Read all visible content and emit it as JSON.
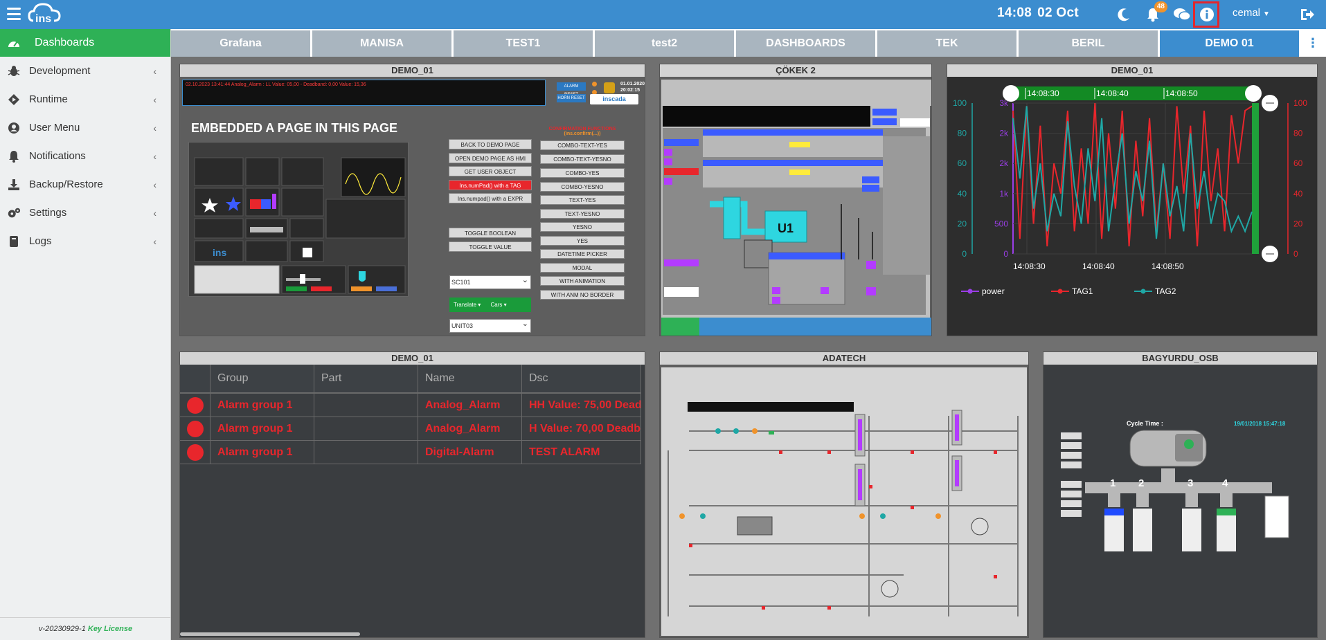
{
  "topbar": {
    "clock_time": "14:08",
    "clock_date": "02 Oct",
    "notifications_count": "48",
    "username": "cemal"
  },
  "sidebar": {
    "active": "Dashboards",
    "items": [
      {
        "label": "Development",
        "icon": "bug-icon"
      },
      {
        "label": "Runtime",
        "icon": "runtime-icon"
      },
      {
        "label": "User Menu",
        "icon": "user-circle-icon"
      },
      {
        "label": "Notifications",
        "icon": "bell-icon"
      },
      {
        "label": "Backup/Restore",
        "icon": "download-icon"
      },
      {
        "label": "Settings",
        "icon": "gears-icon"
      },
      {
        "label": "Logs",
        "icon": "book-icon"
      }
    ],
    "version": "v-20230929-1",
    "license": "Key License"
  },
  "tabs": [
    "Grafana",
    "MANISA",
    "TEST1",
    "test2",
    "DASHBOARDS",
    "TEK",
    "BERIL",
    "DEMO 01"
  ],
  "panels": {
    "p1": {
      "title": "DEMO_01",
      "alarm_msg": "02.10.2023 13:41:44 Analog_Alarm : LL Value: 05,00 - Deadband: 0,00 Value: 15,36",
      "alarm_reset": "ALARM RESET",
      "horn_reset": "HORN RESET",
      "datetime": "01.01.2020 20:02:15",
      "brand": "inscada",
      "heading": "EMBEDDED A PAGE IN THIS PAGE",
      "buttons_left": [
        "BACK TO DEMO PAGE",
        "OPEN DEMO PAGE AS HMI",
        "GET USER OBJECT",
        "Ins.numPad() with a TAG",
        "Ins.numpad() with a EXPR",
        "TOGGLE BOOLEAN",
        "TOGGLE VALUE"
      ],
      "confirm_title": "CONFIRMATION FUNCTIONS",
      "confirm_sub": "(ins.confirm(...))",
      "buttons_right": [
        "COMBO-TEXT-YES",
        "COMBO-TEXT-YESNO",
        "COMBO-YES",
        "COMBO-YESNO",
        "TEXT-YES",
        "TEXT-YESNO",
        "YESNO",
        "YES",
        "DATETIME PICKER",
        "MODAL",
        "WITH ANIMATION",
        "WITH ANM NO BORDER"
      ],
      "select1": "SC101",
      "translate": "Translate",
      "cars": "Cars",
      "select2": "UNIT03"
    },
    "p2": {
      "title": "ÇÖKEK 2",
      "unit": "U1"
    },
    "p3": {
      "title": "DEMO_01"
    },
    "p4": {
      "title": "DEMO_01",
      "columns": [
        "Group",
        "Part",
        "Name",
        "Dsc"
      ],
      "rows": [
        {
          "group": "Alarm group 1",
          "part": "",
          "name": "Analog_Alarm",
          "dsc": "HH Value: 75,00 Dead"
        },
        {
          "group": "Alarm group 1",
          "part": "",
          "name": "Analog_Alarm",
          "dsc": "H Value: 70,00 Deadb"
        },
        {
          "group": "Alarm group 1",
          "part": "",
          "name": "Digital-Alarm",
          "dsc": "TEST ALARM"
        }
      ]
    },
    "p5": {
      "title": "ADATECH"
    },
    "p6": {
      "title": "BAGYURDU_OSB",
      "cycle": "Cycle Time :",
      "datetime": "19/01/2018 15:47:18",
      "streams": [
        "1",
        "2",
        "3",
        "4"
      ]
    }
  },
  "chart_data": {
    "type": "line",
    "title": "",
    "time_labels": [
      "14:08:30",
      "14:08:40",
      "14:08:50"
    ],
    "y_left_power": {
      "ticks": [
        "0",
        "500",
        "1k",
        "2k",
        "2k",
        "3k"
      ]
    },
    "y_left_tag": {
      "ticks": [
        "0",
        "20",
        "40",
        "60",
        "80",
        "100"
      ],
      "ylim": [
        0,
        100
      ]
    },
    "y_right": {
      "ticks": [
        "0",
        "20",
        "40",
        "60",
        "80",
        "100"
      ],
      "ylim": [
        0,
        100
      ]
    },
    "series": [
      {
        "name": "power",
        "color": "#9b3ee8",
        "values": []
      },
      {
        "name": "TAG1",
        "color": "#e8262c",
        "values": [
          95,
          10,
          98,
          20,
          85,
          5,
          60,
          40,
          95,
          15,
          70,
          20,
          100,
          10,
          80,
          30,
          95,
          5,
          75,
          25,
          90,
          15,
          60,
          10,
          98,
          40,
          85,
          5,
          95,
          35,
          70,
          15,
          92,
          60,
          95,
          98
        ]
      },
      {
        "name": "TAG2",
        "color": "#1fa7a5",
        "values": [
          90,
          50,
          98,
          30,
          60,
          15,
          40,
          25,
          88,
          45,
          20,
          70,
          35,
          90,
          15,
          50,
          80,
          20,
          55,
          35,
          75,
          10,
          60,
          25,
          45,
          15,
          80,
          30,
          55,
          20,
          40,
          35,
          15,
          25,
          15,
          28
        ]
      }
    ]
  }
}
